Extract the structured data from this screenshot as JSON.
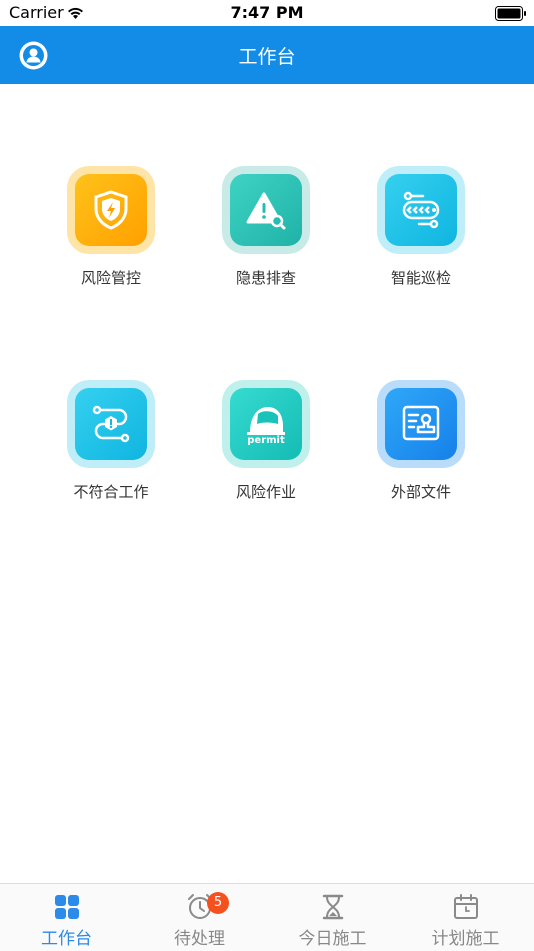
{
  "status": {
    "carrier": "Carrier",
    "time": "7:47 PM"
  },
  "nav": {
    "title": "工作台",
    "avatar_icon": "user-avatar-icon"
  },
  "grid": {
    "items": [
      {
        "label": "风险管控",
        "icon": "shield-lightning-icon",
        "color": "#ffb300"
      },
      {
        "label": "隐患排查",
        "icon": "warning-search-icon",
        "color": "#2ec4b6"
      },
      {
        "label": "智能巡检",
        "icon": "patrol-route-icon",
        "color": "#1ec3e8"
      },
      {
        "label": "不符合工作",
        "icon": "route-warning-icon",
        "color": "#1ec3e8"
      },
      {
        "label": "风险作业",
        "icon": "helmet-permit-icon",
        "color": "#1ec8c0"
      },
      {
        "label": "外部文件",
        "icon": "document-stamp-icon",
        "color": "#1e8ff0"
      }
    ],
    "permit_text": "permit"
  },
  "tabs": [
    {
      "label": "工作台",
      "icon": "grid-icon",
      "active": true
    },
    {
      "label": "待处理",
      "icon": "alarm-clock-icon",
      "badge": "5"
    },
    {
      "label": "今日施工",
      "icon": "hourglass-icon"
    },
    {
      "label": "计划施工",
      "icon": "calendar-icon"
    }
  ],
  "colors": {
    "primary": "#138ce8",
    "badge": "#f4511e",
    "tab_active": "#2c8ae8"
  }
}
